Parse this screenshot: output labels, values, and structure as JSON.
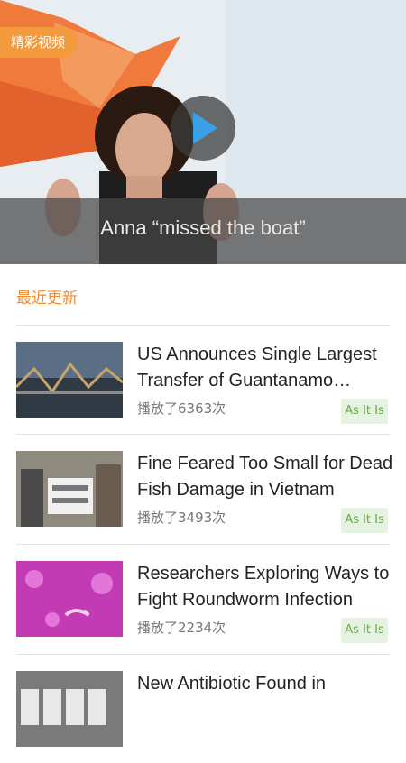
{
  "hero": {
    "badge": "精彩视频",
    "caption": "Anna “missed the boat”",
    "play_icon": "play-icon"
  },
  "recent": {
    "section_title": "最近更新",
    "items": [
      {
        "title": "US Announces Single Largest Transfer of Guantanamo…",
        "views": "播放了6363次",
        "tag": "As It Is"
      },
      {
        "title": "Fine Feared Too Small for Dead Fish Damage in Vietnam",
        "views": "播放了3493次",
        "tag": "As It Is"
      },
      {
        "title": "Researchers Exploring Ways to Fight Roundworm Infection",
        "views": "播放了2234次",
        "tag": "As It Is"
      },
      {
        "title": "New Antibiotic Found in",
        "views": "",
        "tag": ""
      }
    ]
  },
  "colors": {
    "accent": "#f08a2a",
    "tag_bg": "#e5f2df",
    "tag_text": "#6aa84f",
    "play": "#3aa0e6"
  }
}
